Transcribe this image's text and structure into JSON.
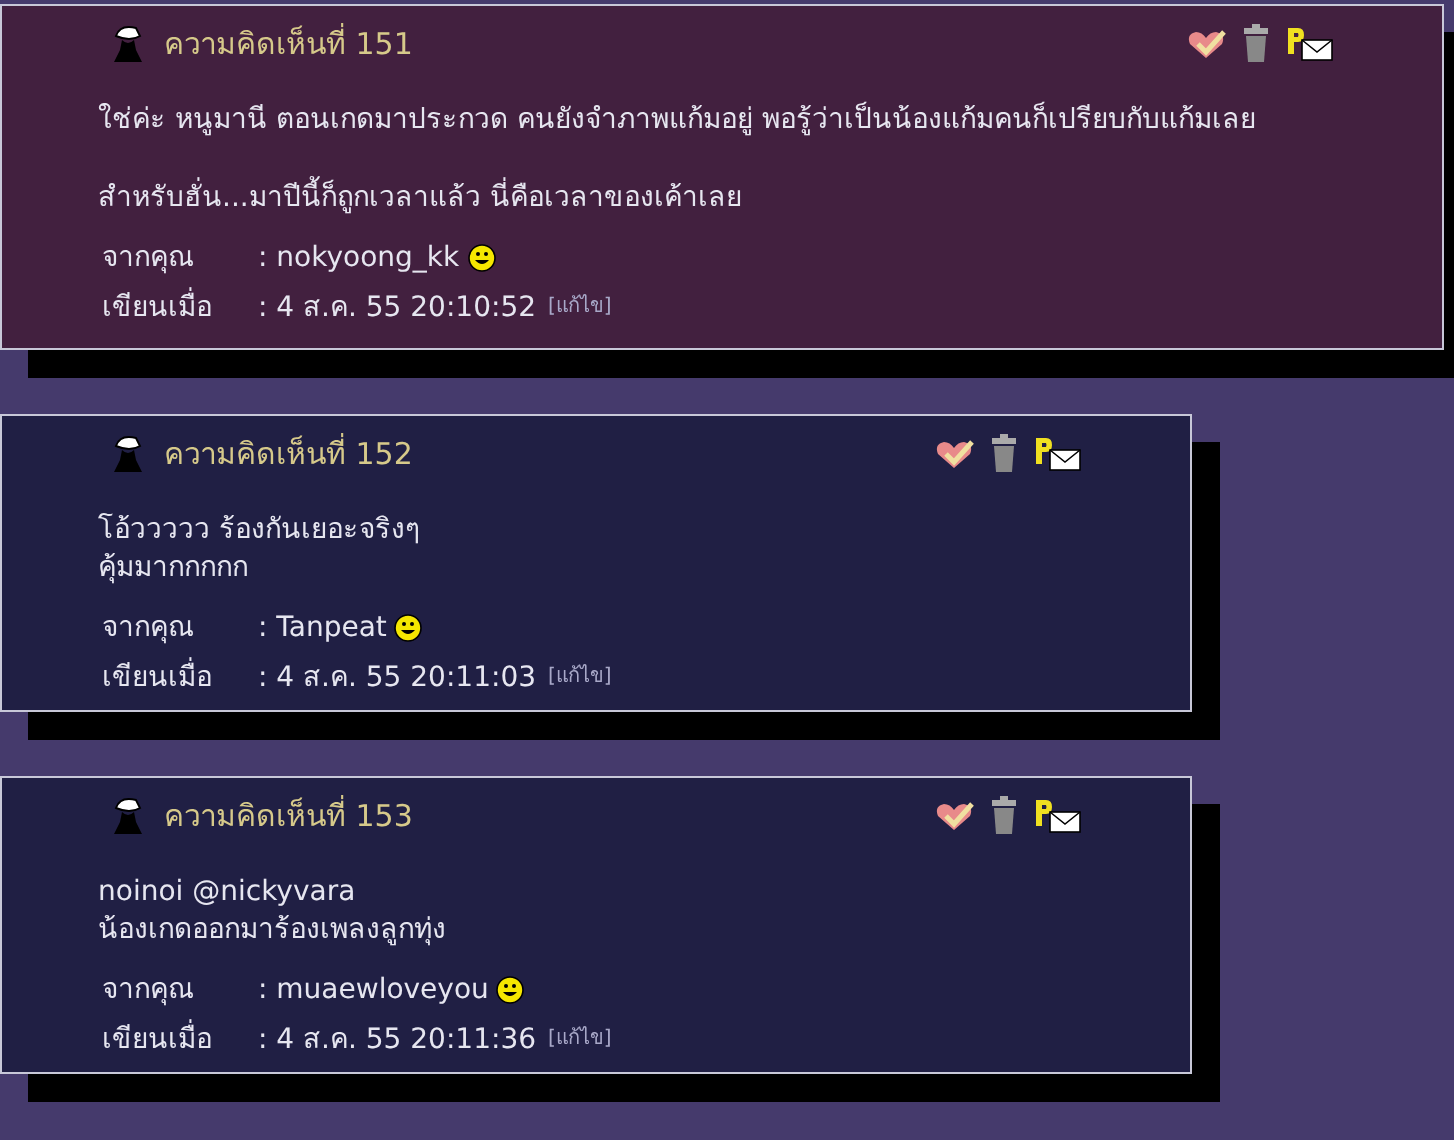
{
  "comments": [
    {
      "title": "ความคิดเห็นที่ 151",
      "highlighted": true,
      "paragraphs": [
        [
          "ใช่ค่ะ หนูมานี ตอนเกดมาประกวด คนยังจำภาพแก้มอยู่  พอรู้ว่าเป็นน้องแก้มคนก็เปรียบกับแก้มเลย"
        ],
        [
          "สำหรับฮั่น...มาปีนี้ก็ถูกเวลาแล้ว  นี่คือเวลาของเค้าเลย"
        ]
      ],
      "from_label": "จากคุณ",
      "from": ": nokyoong_kk",
      "date_label": "เขียนเมื่อ",
      "date": ": 4 ส.ค. 55 20:10:52",
      "edit": "[แก้ไข]"
    },
    {
      "title": "ความคิดเห็นที่ 152",
      "highlighted": false,
      "paragraphs": [
        [
          "โอ้ววววว ร้องกันเยอะจริงๆ",
          "คุ้มมากกกกก"
        ]
      ],
      "from_label": "จากคุณ",
      "from": ": Tanpeat",
      "date_label": "เขียนเมื่อ",
      "date": ": 4 ส.ค. 55 20:11:03",
      "edit": "[แก้ไข]"
    },
    {
      "title": "ความคิดเห็นที่ 153",
      "highlighted": false,
      "paragraphs": [
        [
          "noinoi @nickyvara",
          "น้องเกดออกมาร้องเพลงลูกทุ่ง"
        ]
      ],
      "from_label": "จากคุณ",
      "from": ": muaewloveyou",
      "date_label": "เขียนเมื่อ",
      "date": ": 4 ส.ค. 55 20:11:36",
      "edit": "[แก้ไข]"
    }
  ]
}
